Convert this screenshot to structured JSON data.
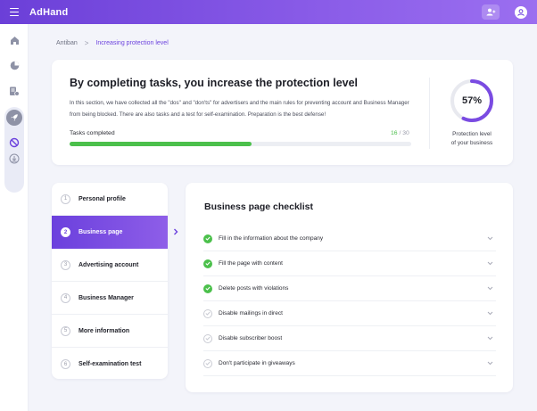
{
  "app": {
    "brand": "AdHand"
  },
  "colors": {
    "accent": "#6b40dd",
    "success": "#4bc04b",
    "muted": "#c9cbd3"
  },
  "sidebar": {
    "items": [
      {
        "icon": "home-icon"
      },
      {
        "icon": "pie-chart-icon"
      },
      {
        "icon": "document-settings-icon"
      },
      {
        "icon": "rocket-icon"
      },
      {
        "icon": "block-icon"
      },
      {
        "icon": "download-circle-icon"
      }
    ]
  },
  "breadcrumb": {
    "root": "Antiban",
    "separator": ">",
    "current": "Increasing protection level"
  },
  "hero": {
    "title": "By completing tasks, you increase the protection level",
    "description": "In this section, we have collected all the \"dos\" and \"don'ts\" for advertisers and the main rules for preventing account and Business Manager from being blocked. There are also tasks and a test for self-examination. Preparation is the best defense!",
    "tasks_label": "Tasks completed",
    "tasks_done": "16",
    "tasks_total": "/ 30",
    "progress_fraction": 0.533,
    "protection_percent": 57,
    "protection_text": "57%",
    "protection_caption_line1": "Protection level",
    "protection_caption_line2": "of your business"
  },
  "steps": [
    {
      "num": "1",
      "label": "Personal profile",
      "active": false
    },
    {
      "num": "2",
      "label": "Business page",
      "active": true
    },
    {
      "num": "3",
      "label": "Advertising account",
      "active": false
    },
    {
      "num": "4",
      "label": "Business Manager",
      "active": false
    },
    {
      "num": "5",
      "label": "More information",
      "active": false
    },
    {
      "num": "6",
      "label": "Self-examination test",
      "active": false
    }
  ],
  "checklist": {
    "title": "Business page checklist",
    "items": [
      {
        "label": "Fill in the information about the company",
        "done": true
      },
      {
        "label": "Fill the page with content",
        "done": true
      },
      {
        "label": "Delete posts with violations",
        "done": true
      },
      {
        "label": "Disable mailings in direct",
        "done": false
      },
      {
        "label": "Disable subscriber boost",
        "done": false
      },
      {
        "label": "Don't participate in giveaways",
        "done": false
      }
    ]
  }
}
